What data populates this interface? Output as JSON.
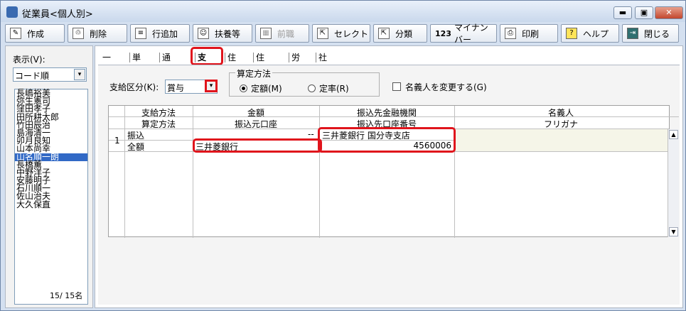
{
  "window": {
    "title": "従業員<個人別>",
    "min": "▬",
    "max": "▣",
    "close": "✕"
  },
  "toolbar": {
    "create": "作成",
    "delete": "削除",
    "add_row": "行追加",
    "dependents": "扶養等",
    "previous": "前職",
    "select": "セレクト",
    "category": "分類",
    "mynumber": "マイナンバー",
    "print": "印刷",
    "help": "ヘルプ",
    "close": "閉じる",
    "mynumber_icon_text": "123"
  },
  "left": {
    "display_label": "表示(V):",
    "sort_value": "コード順",
    "employees": [
      "長嶋裕美",
      "弥生憲司",
      "窪田孝子",
      "田所耕太郎",
      "竹田辰治",
      "島海清一",
      "卯月良知",
      "山本尚幸",
      "山名順一朗",
      "長橋薫",
      "中野洋子",
      "安藤明子",
      "石川順一",
      "佐山治夫",
      "大久保直"
    ],
    "selected_index": 8,
    "counter": "15/ 15名"
  },
  "tabs": [
    "一般",
    "単価",
    "通勤費",
    "支給",
    "住所",
    "住民税",
    "労保",
    "社保"
  ],
  "active_tab": 3,
  "form": {
    "payment_class_label": "支給区分(K):",
    "payment_class_value": "賞与",
    "calc_method_title": "算定方法",
    "fixed_amount": "定額(M)",
    "fixed_rate": "定率(R)",
    "change_name_label": "名義人を変更する(G)"
  },
  "grid": {
    "headers_top": [
      "支給方法",
      "金額",
      "振込先金融機関",
      "名義人"
    ],
    "headers_bottom": [
      "算定方法",
      "振込元口座",
      "振込先口座番号",
      "フリガナ"
    ],
    "row_num": "1",
    "method": "振込",
    "calc": "全額",
    "amount": "--",
    "source_account": "三井菱銀行",
    "dest_bank": "三井菱銀行 国分寺支店",
    "account_number": "4560006"
  },
  "colors": {
    "highlight": "#e0141c",
    "selection": "#3169c6"
  }
}
